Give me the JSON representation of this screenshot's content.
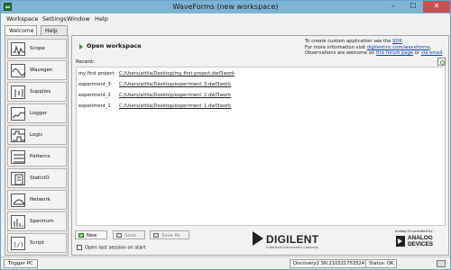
{
  "window": {
    "title": "WaveForms  (new workspace)",
    "controls": {
      "minimize": "–",
      "maximize": "☐",
      "close": "✕"
    }
  },
  "menu": [
    "Workspace",
    "Settings",
    "Window",
    "Help"
  ],
  "tabs": [
    {
      "label": "Welcome",
      "active": true
    },
    {
      "label": "Help",
      "active": false
    }
  ],
  "sidebar": {
    "items": [
      {
        "label": "Scope",
        "icon": "scope-icon"
      },
      {
        "label": "Wavegen",
        "icon": "wavegen-icon"
      },
      {
        "label": "Supplies",
        "icon": "supplies-icon"
      },
      {
        "label": "Logger",
        "icon": "logger-icon"
      },
      {
        "label": "Logic",
        "icon": "logic-icon"
      },
      {
        "label": "Patterns",
        "icon": "patterns-icon"
      },
      {
        "label": "StaticIO",
        "icon": "staticio-icon"
      },
      {
        "label": "Network",
        "icon": "network-icon"
      },
      {
        "label": "Spectrum",
        "icon": "spectrum-icon"
      },
      {
        "label": "Script",
        "icon": "script-icon"
      }
    ]
  },
  "main": {
    "open_workspace": "Open workspace",
    "info": {
      "line1_prefix": "To create custom application see the ",
      "line1_link": "SDK",
      "line1_suffix": ".",
      "line2_prefix": "For more information visit ",
      "line2_link": "digilentinc.com/waveforms",
      "line2_suffix": ".",
      "line3_prefix": "Observations are welcome on ",
      "line3_link1": "this forum page",
      "line3_mid": " or ",
      "line3_link2": "via email",
      "line3_suffix": "."
    },
    "recent_label": "Recent:",
    "recent": [
      {
        "name": "my first project",
        "path": "C:/Users/attila/Desktop/my first project.dwf3work"
      },
      {
        "name": "experiment_3",
        "path": "C:/Users/attila/Desktop/experiment_3.dwf3work"
      },
      {
        "name": "experiment_2",
        "path": "C:/Users/attila/Desktop/experiment_2.dwf3work"
      },
      {
        "name": "experiment_1",
        "path": "C:/Users/attila/Desktop/experiment_1.dwf3work"
      }
    ],
    "buttons": {
      "new": "New",
      "save": "Save",
      "save_as": "Save As"
    },
    "open_last_session": "Open last session on start",
    "brand": {
      "digilent_name": "DIGILENT",
      "digilent_sub": "A National Instruments Company",
      "adi_caption": "Analog ICs provided by",
      "adi_name_line1": "ANALOG",
      "adi_name_line2": "DEVICES"
    }
  },
  "statusbar": {
    "trigger": "Trigger PC",
    "device": "Discovery2 SN:210321753524",
    "status": "Status: OK"
  },
  "colors": {
    "titlebar": "#7fb3d3",
    "close_button": "#c75050",
    "link": "#0645ad",
    "accent_green": "#2e9a2e"
  }
}
